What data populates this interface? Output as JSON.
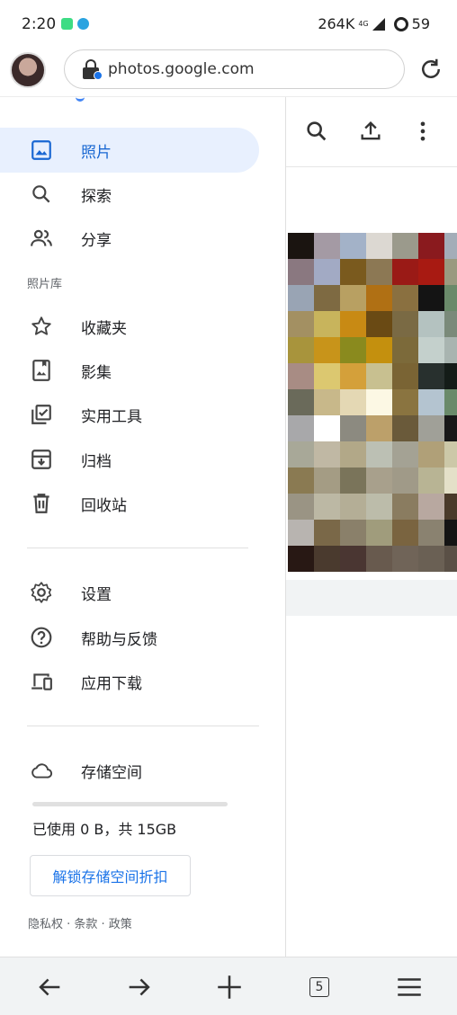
{
  "status_bar": {
    "time": "2:20",
    "network_speed": "264K",
    "network_type": "4G",
    "battery": "59"
  },
  "browser": {
    "url": "photos.google.com",
    "tab_count": "5"
  },
  "drawer": {
    "nav_items": [
      {
        "label": "照片",
        "icon": "photo-icon",
        "active": true
      },
      {
        "label": "探索",
        "icon": "search-icon"
      },
      {
        "label": "分享",
        "icon": "people-icon"
      }
    ],
    "library_label": "照片库",
    "library_items": [
      {
        "label": "收藏夹",
        "icon": "star-icon"
      },
      {
        "label": "影集",
        "icon": "album-icon"
      },
      {
        "label": "实用工具",
        "icon": "utilities-icon"
      },
      {
        "label": "归档",
        "icon": "archive-icon"
      },
      {
        "label": "回收站",
        "icon": "trash-icon"
      }
    ],
    "settings_items": [
      {
        "label": "设置",
        "icon": "gear-icon"
      },
      {
        "label": "帮助与反馈",
        "icon": "help-icon"
      },
      {
        "label": "应用下载",
        "icon": "devices-icon"
      }
    ],
    "storage": {
      "label": "存储空间",
      "icon": "cloud-icon",
      "usage_text": "已使用 0 B，共 15GB",
      "used_fraction": 0,
      "unlock_label": "解锁存储空间折扣"
    },
    "footer": "隐私权 · 条款 · 政策"
  },
  "toolbar_icons": [
    "search-icon",
    "upload-icon",
    "more-vert-icon"
  ],
  "colors": {
    "accent": "#1a73e8",
    "active_bg": "#e8f0fe"
  },
  "photo_pixels": [
    "#1a1410",
    "#a49aa4",
    "#a3b2c8",
    "#dcd8d2",
    "#9b9a8c",
    "#8a1a1e",
    "#a3adb8",
    "#8a7880",
    "#a2aac4",
    "#7a5a1e",
    "#8c7854",
    "#9a1a16",
    "#a81a12",
    "#9a9a80",
    "#99a4b4",
    "#7e6a42",
    "#b8a062",
    "#b07014",
    "#8a7040",
    "#141414",
    "#6a8a6a",
    "#a39062",
    "#c8b45c",
    "#c88a14",
    "#6a4a14",
    "#7a6a44",
    "#b4c2c0",
    "#7a8a7a",
    "#a8943c",
    "#c8941a",
    "#8a8a1e",
    "#c4900e",
    "#7c6a3a",
    "#c4d0cc",
    "#a8b4b0",
    "#a88c84",
    "#dcc870",
    "#d4a03a",
    "#c8c090",
    "#7a6434",
    "#28302e",
    "#141c18",
    "#6a6a5a",
    "#c8b88a",
    "#e4d8b4",
    "#fcf8e4",
    "#8a7440",
    "#b4c4d0",
    "#6a8a6a",
    "#a8a8aa",
    "#ffffff",
    "#8c8a80",
    "#bca06a",
    "#6a5a3a",
    "#a0a098",
    "#181818",
    "#a8a898",
    "#c0b8a4",
    "#b2a888",
    "#bcc0b4",
    "#a4a294",
    "#b0a078",
    "#ccc8a8",
    "#8a7a52",
    "#a49c84",
    "#7a745a",
    "#a8a08c",
    "#a09a88",
    "#b8b494",
    "#e4e0c8",
    "#9a9484",
    "#bcb8a4",
    "#b4ae96",
    "#bcbcaa",
    "#8a7c60",
    "#b8a8a0",
    "#4a3a2a",
    "#b8b4b0",
    "#7a6848",
    "#8a806a",
    "#a09c7c",
    "#7a6440",
    "#8a8270",
    "#141414",
    "#281814",
    "#4a3a2e",
    "#4a3632",
    "#685a4e",
    "#706458",
    "#6a6054",
    "#5a5046"
  ]
}
